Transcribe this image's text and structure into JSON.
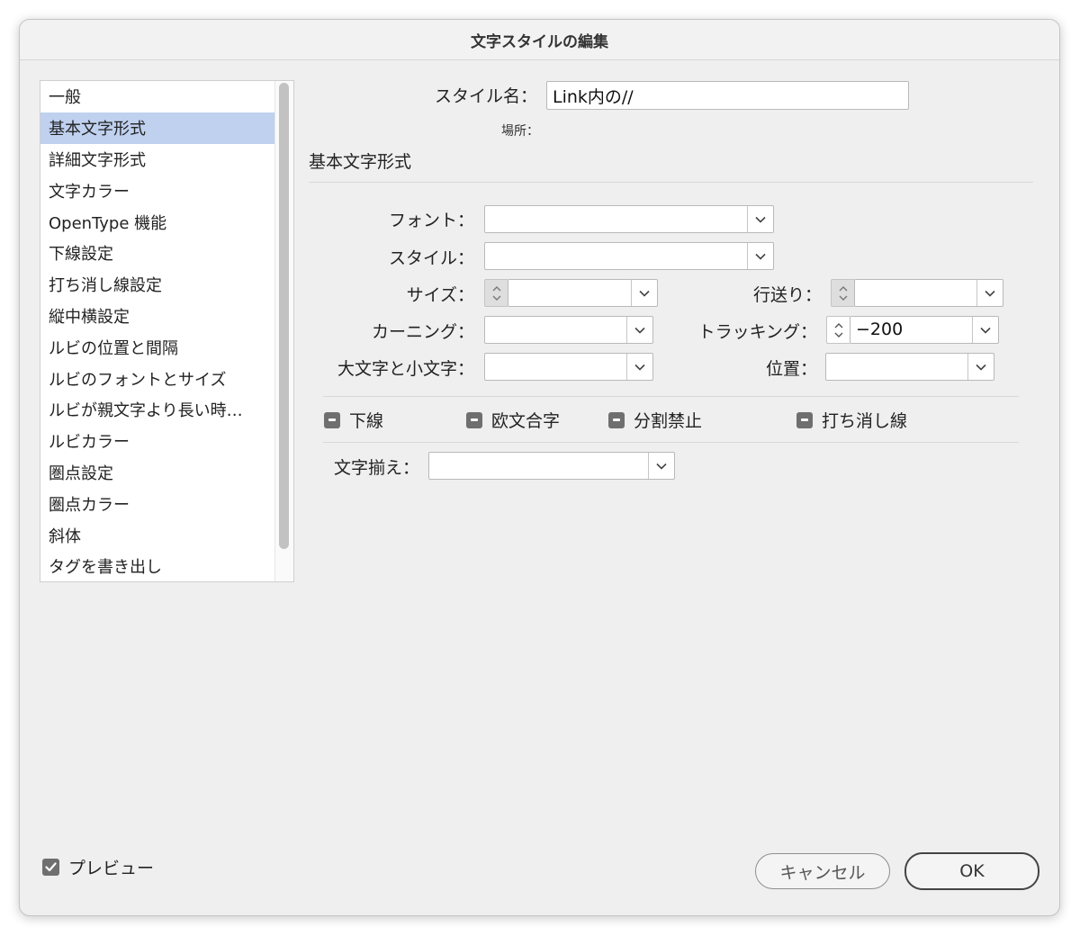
{
  "window": {
    "title": "文字スタイルの編集"
  },
  "sidebar": {
    "items": [
      {
        "label": "一般",
        "selected": false
      },
      {
        "label": "基本文字形式",
        "selected": true
      },
      {
        "label": "詳細文字形式",
        "selected": false
      },
      {
        "label": "文字カラー",
        "selected": false
      },
      {
        "label": "OpenType 機能",
        "selected": false
      },
      {
        "label": "下線設定",
        "selected": false
      },
      {
        "label": "打ち消し線設定",
        "selected": false
      },
      {
        "label": "縦中横設定",
        "selected": false
      },
      {
        "label": "ルビの位置と間隔",
        "selected": false
      },
      {
        "label": "ルビのフォントとサイズ",
        "selected": false
      },
      {
        "label": "ルビが親文字より長い時…",
        "selected": false
      },
      {
        "label": "ルビカラー",
        "selected": false
      },
      {
        "label": "圏点設定",
        "selected": false
      },
      {
        "label": "圏点カラー",
        "selected": false
      },
      {
        "label": "斜体",
        "selected": false
      },
      {
        "label": "タグを書き出し",
        "selected": false
      }
    ]
  },
  "style_name": {
    "label": "スタイル名：",
    "value": "Link内の//"
  },
  "location": {
    "label": "場所："
  },
  "section": {
    "title": "基本文字形式"
  },
  "fields": {
    "font": {
      "label": "フォント：",
      "value": ""
    },
    "style": {
      "label": "スタイル：",
      "value": ""
    },
    "size": {
      "label": "サイズ：",
      "value": ""
    },
    "leading": {
      "label": "行送り：",
      "value": ""
    },
    "kerning": {
      "label": "カーニング：",
      "value": ""
    },
    "tracking": {
      "label": "トラッキング：",
      "value": "−200"
    },
    "case": {
      "label": "大文字と小文字：",
      "value": ""
    },
    "position": {
      "label": "位置：",
      "value": ""
    },
    "alignment": {
      "label": "文字揃え：",
      "value": ""
    }
  },
  "checkboxes": {
    "underline": {
      "label": "下線",
      "state": "mixed"
    },
    "ligatures": {
      "label": "欧文合字",
      "state": "mixed"
    },
    "no_break": {
      "label": "分割禁止",
      "state": "mixed"
    },
    "strikethrough": {
      "label": "打ち消し線",
      "state": "mixed"
    }
  },
  "preview": {
    "label": "プレビュー",
    "checked": true
  },
  "buttons": {
    "cancel": "キャンセル",
    "ok": "OK"
  },
  "colors": {
    "selection": "#bfd1ef",
    "checkbox": "#6f6f6f"
  }
}
